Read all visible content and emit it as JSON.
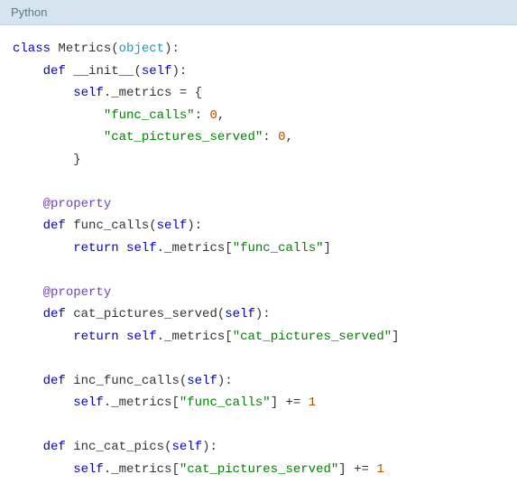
{
  "header": {
    "language": "Python"
  },
  "code": {
    "class_kw": "class",
    "class_name": "Metrics",
    "base_class": "object",
    "def_kw": "def",
    "self_kw": "self",
    "return_kw": "return",
    "property_deco": "@property",
    "init_name": "__init__",
    "metrics_attr": "._metrics",
    "eq": " = ",
    "brace_open": "{",
    "brace_close": "}",
    "key_func_calls": "\"func_calls\"",
    "key_cat_pictures": "\"cat_pictures_served\"",
    "zero": "0",
    "one": "1",
    "fn_func_calls": "func_calls",
    "fn_cat_pictures_served": "cat_pictures_served",
    "fn_inc_func_calls": "inc_func_calls",
    "fn_inc_cat_pics": "inc_cat_pics",
    "plus_eq": " += ",
    "comma": ",",
    "colon": ":",
    "paren_open": "(",
    "paren_close": ")",
    "bracket_open": "[",
    "bracket_close": "]"
  }
}
